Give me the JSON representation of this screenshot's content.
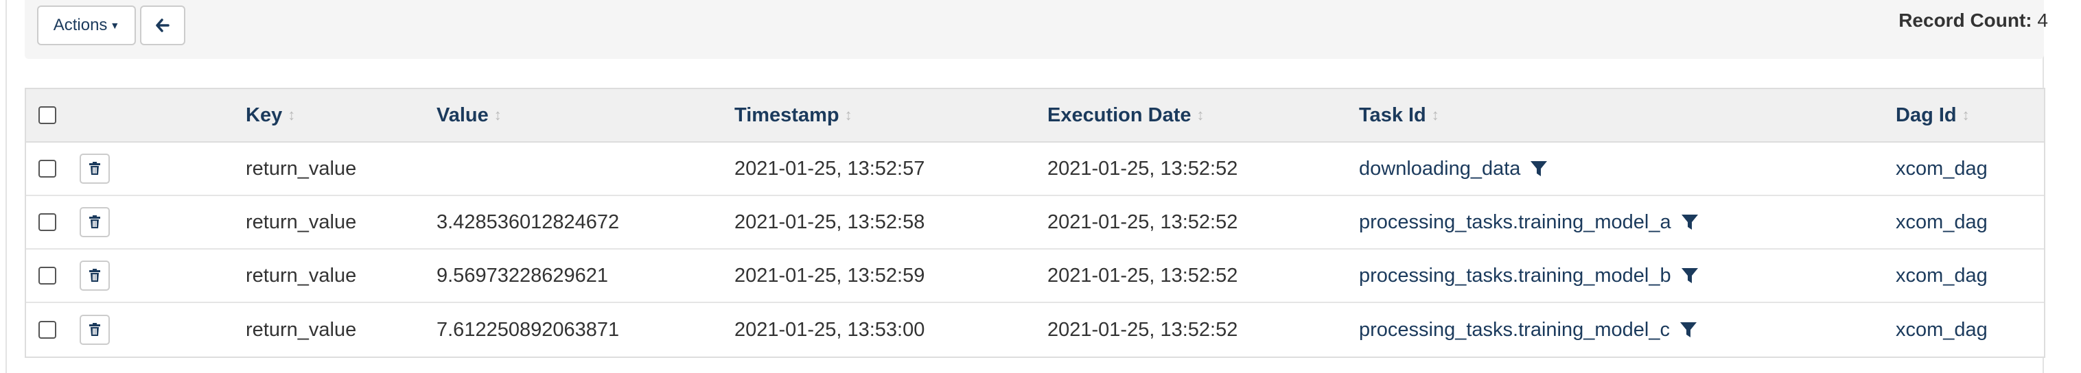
{
  "toolbar": {
    "actions_label": "Actions",
    "record_count_label": "Record Count:",
    "record_count_value": "4"
  },
  "table": {
    "columns": {
      "key": "Key",
      "value": "Value",
      "timestamp": "Timestamp",
      "execution_date": "Execution Date",
      "task_id": "Task Id",
      "dag_id": "Dag Id"
    },
    "rows": [
      {
        "key": "return_value",
        "value": "",
        "timestamp": "2021-01-25, 13:52:57",
        "execution_date": "2021-01-25, 13:52:52",
        "task_id": "downloading_data",
        "dag_id": "xcom_dag"
      },
      {
        "key": "return_value",
        "value": "3.428536012824672",
        "timestamp": "2021-01-25, 13:52:58",
        "execution_date": "2021-01-25, 13:52:52",
        "task_id": "processing_tasks.training_model_a",
        "dag_id": "xcom_dag"
      },
      {
        "key": "return_value",
        "value": "9.56973228629621",
        "timestamp": "2021-01-25, 13:52:59",
        "execution_date": "2021-01-25, 13:52:52",
        "task_id": "processing_tasks.training_model_b",
        "dag_id": "xcom_dag"
      },
      {
        "key": "return_value",
        "value": "7.612250892063871",
        "timestamp": "2021-01-25, 13:53:00",
        "execution_date": "2021-01-25, 13:52:52",
        "task_id": "processing_tasks.training_model_c",
        "dag_id": "xcom_dag"
      }
    ]
  },
  "icons": {
    "back": "arrow-left-icon",
    "delete": "trash-icon",
    "filter": "filter-icon",
    "sort": "sort-icon"
  },
  "colors": {
    "link": "#1b3a5c",
    "header_bg": "#f0f0f0",
    "well_bg": "#f5f5f5"
  }
}
